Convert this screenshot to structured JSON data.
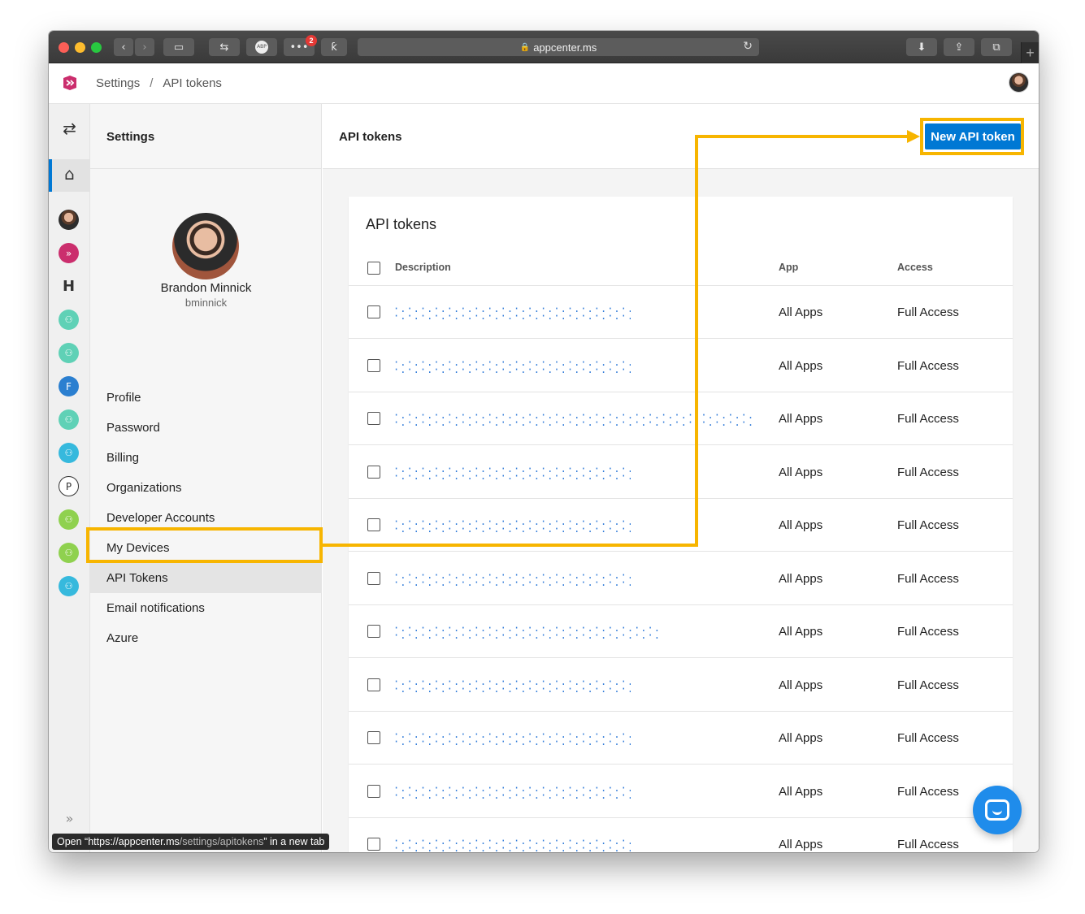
{
  "browser": {
    "url": "appcenter.ms",
    "notification_count": "2",
    "status_tip_prefix": "Open “",
    "status_tip_url_host": "https://appcenter.ms",
    "status_tip_url_path": "/settings/apitokens",
    "status_tip_suffix": "” in a new tab"
  },
  "header": {
    "breadcrumb_root": "Settings",
    "breadcrumb_sep": "/",
    "breadcrumb_current": "API tokens"
  },
  "rail": {
    "items": [
      {
        "icon": "user-avatar-icon",
        "color": "#5a3b2a"
      },
      {
        "icon": "app-center-app-icon",
        "color": "#cb2e6d"
      },
      {
        "icon": "hacker-news-app-icon",
        "color": "#ffffff"
      },
      {
        "icon": "team-app-icon",
        "color": "#5fd1b6"
      },
      {
        "icon": "team-app-icon",
        "color": "#5fd1b6"
      },
      {
        "icon": "f-app-icon",
        "color": "#2b7fd0",
        "letter": "F"
      },
      {
        "icon": "team-app-icon",
        "color": "#5fd1b6"
      },
      {
        "icon": "team-app-icon",
        "color": "#36b9dd"
      },
      {
        "icon": "p-app-icon",
        "color": "#ffffff",
        "letter": "P"
      },
      {
        "icon": "team-app-icon",
        "color": "#8fd14f"
      },
      {
        "icon": "team-app-icon",
        "color": "#8fd14f"
      },
      {
        "icon": "team-app-icon",
        "color": "#36b9dd"
      }
    ]
  },
  "settings": {
    "title": "Settings",
    "profile_name": "Brandon Minnick",
    "profile_username": "bminnick",
    "nav": [
      {
        "label": "Profile"
      },
      {
        "label": "Password"
      },
      {
        "label": "Billing"
      },
      {
        "label": "Organizations"
      },
      {
        "label": "Developer Accounts"
      },
      {
        "label": "My Devices"
      },
      {
        "label": "API Tokens",
        "active": true
      },
      {
        "label": "Email notifications"
      },
      {
        "label": "Azure"
      }
    ]
  },
  "main": {
    "title": "API tokens",
    "new_button": "New API token",
    "card_title": "API tokens",
    "columns": {
      "description": "Description",
      "app": "App",
      "access": "Access"
    },
    "rows": [
      {
        "app": "All Apps",
        "access": "Full Access"
      },
      {
        "app": "All Apps",
        "access": "Full Access"
      },
      {
        "app": "All Apps",
        "access": "Full Access"
      },
      {
        "app": "All Apps",
        "access": "Full Access"
      },
      {
        "app": "All Apps",
        "access": "Full Access"
      },
      {
        "app": "All Apps",
        "access": "Full Access"
      },
      {
        "app": "All Apps",
        "access": "Full Access"
      },
      {
        "app": "All Apps",
        "access": "Full Access"
      },
      {
        "app": "All Apps",
        "access": "Full Access"
      },
      {
        "app": "All Apps",
        "access": "Full Access"
      },
      {
        "app": "All Apps",
        "access": "Full Access"
      }
    ]
  },
  "colors": {
    "accent": "#0078d4",
    "annotation": "#f7b500",
    "chat": "#1f8ceb"
  }
}
